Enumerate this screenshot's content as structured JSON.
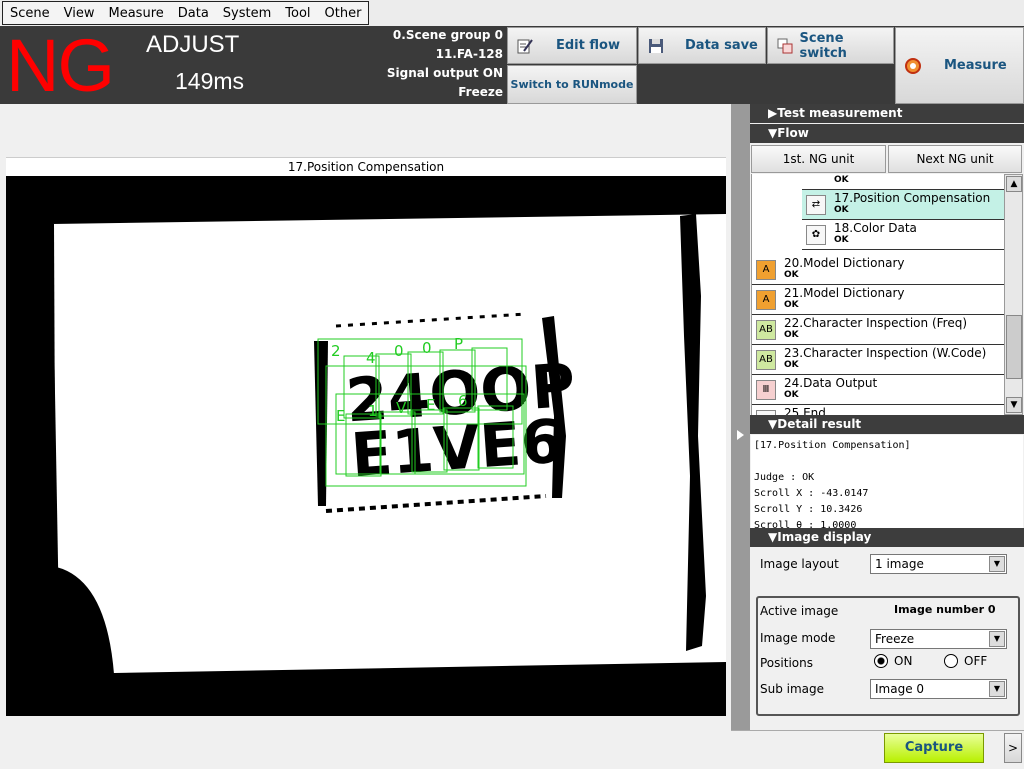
{
  "menu": [
    "Scene",
    "View",
    "Measure",
    "Data",
    "System",
    "Tool",
    "Other"
  ],
  "header": {
    "judge": "NG",
    "mode": "ADJUST",
    "time": "149ms",
    "scene_group": "0.Scene group 0",
    "scene_name": "11.FA-128",
    "signal_output": "Signal output ON",
    "freeze": "Freeze"
  },
  "buttons": {
    "edit_flow": "Edit flow",
    "switch_run": "Switch to RUNmode",
    "data_save": "Data save",
    "scene_switch": "Scene switch",
    "measure": "Measure",
    "first_ng": "1st. NG unit",
    "next_ng": "Next NG unit",
    "capture": "Capture",
    "expand": ">"
  },
  "image_title": "17.Position Compensation",
  "sections": {
    "test_measurement": "Test measurement",
    "flow": "Flow",
    "detail_result": "Detail result",
    "image_display": "Image display"
  },
  "flow_partial_status": "OK",
  "flow_items": [
    {
      "label": "17.Position Compensation",
      "status": "OK",
      "icon": "position-compensation-icon",
      "selected": true,
      "sub": true
    },
    {
      "label": "18.Color Data",
      "status": "OK",
      "icon": "color-data-icon",
      "selected": false,
      "sub": true
    },
    {
      "label": "20.Model Dictionary",
      "status": "OK",
      "icon": "model-dictionary-icon",
      "selected": false,
      "sub": false
    },
    {
      "label": "21.Model Dictionary",
      "status": "OK",
      "icon": "model-dictionary-icon",
      "selected": false,
      "sub": false
    },
    {
      "label": "22.Character Inspection (Freq)",
      "status": "OK",
      "icon": "character-inspection-icon",
      "selected": false,
      "sub": false
    },
    {
      "label": "23.Character Inspection (W.Code)",
      "status": "OK",
      "icon": "character-inspection-icon",
      "selected": false,
      "sub": false
    },
    {
      "label": "24.Data Output",
      "status": "OK",
      "icon": "data-output-icon",
      "selected": false,
      "sub": false
    },
    {
      "label": "25.End",
      "status": "",
      "icon": "end-icon",
      "selected": false,
      "sub": false
    }
  ],
  "detail": {
    "header": "[17.Position Compensation]",
    "judge": "Judge : OK",
    "scroll_x": "Scroll X : -43.0147",
    "scroll_y": "Scroll Y : 10.3426",
    "scroll_theta": "Scroll θ : 1.0000"
  },
  "image_display": {
    "layout_label": "Image layout",
    "layout_value": "1 image",
    "active_image_label": "Active image",
    "active_image_value": "Image number 0",
    "image_mode_label": "Image mode",
    "image_mode_value": "Freeze",
    "positions_label": "Positions",
    "positions_on": "ON",
    "positions_off": "OFF",
    "positions_selected": "ON",
    "sub_image_label": "Sub image",
    "sub_image_value": "Image 0"
  },
  "image": {
    "printed_text_line1": "24OOP",
    "printed_text_line2": "E1VE6",
    "overlay_chars_line1": [
      "2",
      "4",
      "0",
      "0",
      "P"
    ],
    "overlay_chars_line2": [
      "E",
      "1",
      "V",
      "E",
      "6"
    ],
    "overlay_color": "#22cc22"
  },
  "colors": {
    "ng_red": "#ff0000",
    "header_bg": "#3a3a3a",
    "button_text": "#1a5580",
    "capture_green": "#c8f53a",
    "selected_row": "#c4f1e6"
  }
}
